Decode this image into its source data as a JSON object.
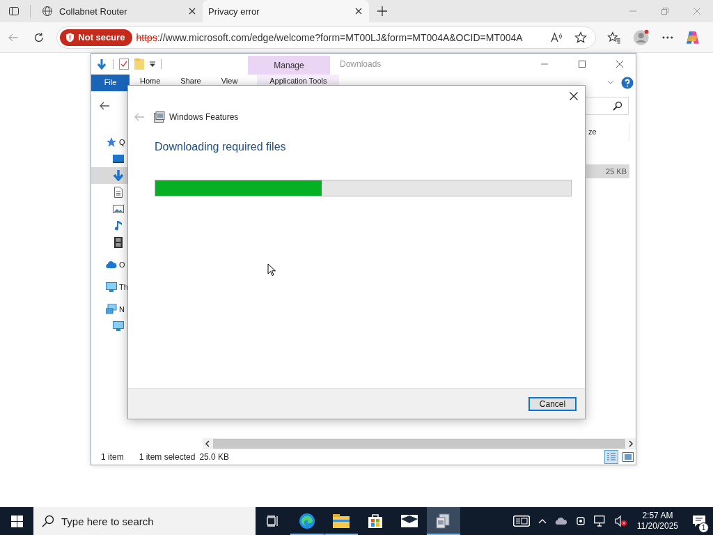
{
  "browser": {
    "tabs": [
      {
        "title": "Collabnet Router",
        "selected": false
      },
      {
        "title": "Privacy error",
        "selected": true
      }
    ],
    "address": {
      "security_badge": "Not secure",
      "scheme": "https",
      "rest": "://www.microsoft.com/edge/welcome?form=MT00LJ&form=MT004A&OCID=MT004A"
    }
  },
  "explorer": {
    "title": "Downloads",
    "context_tab": "Manage",
    "ribbon_tabs": [
      {
        "label": "File",
        "kind": "file"
      },
      {
        "label": "Home",
        "kind": "plain"
      },
      {
        "label": "Share",
        "kind": "plain"
      },
      {
        "label": "View",
        "kind": "plain"
      },
      {
        "label": "Application Tools",
        "kind": "context"
      }
    ],
    "nav_items": [
      {
        "kind": "star",
        "label": "Q",
        "selected": false,
        "children": [
          {
            "kind": "desktop",
            "selected": false
          },
          {
            "kind": "download",
            "selected": true
          },
          {
            "kind": "document",
            "selected": false
          },
          {
            "kind": "picture",
            "selected": false
          },
          {
            "kind": "music",
            "selected": false
          },
          {
            "kind": "video",
            "selected": false
          }
        ]
      },
      {
        "kind": "cloud",
        "label": "O",
        "selected": false
      },
      {
        "kind": "pc",
        "label": "Th",
        "selected": false
      },
      {
        "kind": "network",
        "label": "N",
        "selected": false,
        "children": [
          {
            "kind": "pc",
            "selected": false
          }
        ]
      }
    ],
    "column_header": "ze",
    "file_size": "25 KB",
    "status": [
      "1 item",
      "1 item selected",
      "25.0 KB"
    ]
  },
  "dialog": {
    "title": "Windows Features",
    "heading": "Downloading required files",
    "progress": {
      "level": 0.4
    },
    "buttons": [
      "Cancel"
    ]
  },
  "taskbar": {
    "search_placeholder": "Type here to search",
    "time": "2:57 AM",
    "date": "11/20/2025",
    "notification_count": "1"
  }
}
